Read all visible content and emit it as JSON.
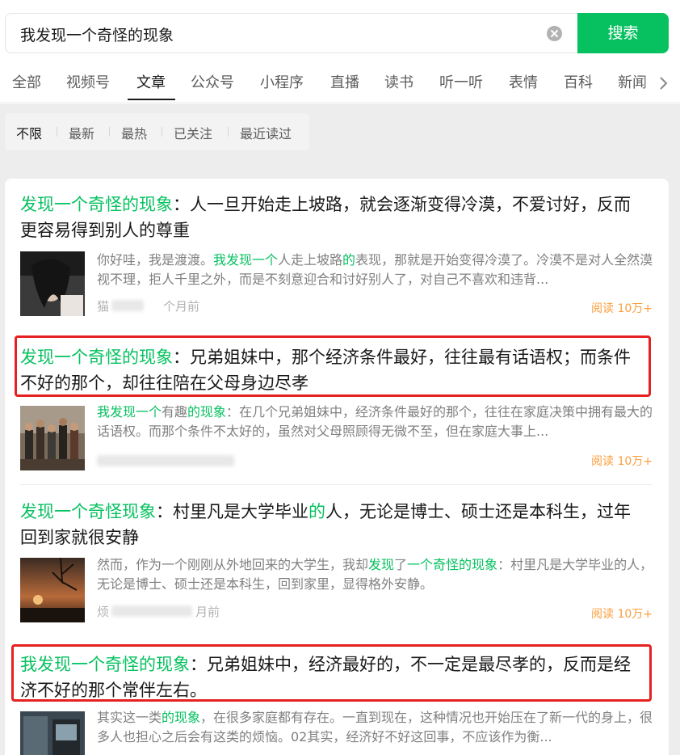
{
  "search": {
    "query": "我发现一个奇怪的现象",
    "button_label": "搜索"
  },
  "tabs": [
    "全部",
    "视频号",
    "文章",
    "公众号",
    "小程序",
    "直播",
    "读书",
    "听一听",
    "表情",
    "百科",
    "新闻"
  ],
  "filters": [
    "不限",
    "最新",
    "最热",
    "已关注",
    "最近读过"
  ],
  "results": [
    {
      "title_parts": [
        {
          "text": "发现一个奇怪的现象",
          "hl": true
        },
        {
          "text": "：人一旦开始走上坡路，就会逐渐变得冷漠，不爱讨好，反而更容易得到别人的尊重",
          "hl": false
        }
      ],
      "snippet_parts": [
        {
          "text": "你好哇，我是渡渡。",
          "hl": false
        },
        {
          "text": "我发现一个",
          "hl": true
        },
        {
          "text": "人走上坡路",
          "hl": false
        },
        {
          "text": "的",
          "hl": true
        },
        {
          "text": "表现，那就是开始变得冷漠了。冷漠不是对人全然漠视不理，拒人千里之外，而是不刻意迎合和讨好别人了，对自己不喜欢和违背...",
          "hl": false
        }
      ],
      "source": "猫",
      "time": "个月前",
      "read": "阅读 10万+"
    },
    {
      "title_parts": [
        {
          "text": "发现一个奇怪的现象",
          "hl": true
        },
        {
          "text": "：兄弟姐妹中，那个经济条件最好，往往最有话语权；而条件不好的那个，却往往陪在父母身边尽孝",
          "hl": false
        }
      ],
      "snippet_parts": [
        {
          "text": "我发现一个",
          "hl": true
        },
        {
          "text": "有趣",
          "hl": false
        },
        {
          "text": "的现象",
          "hl": true
        },
        {
          "text": "：在几个兄弟姐妹中，经济条件最好的那个，往往在家庭决策中拥有最大的话语权。而那个条件不太好的，虽然对父母照顾得无微不至，但在家庭大事上...",
          "hl": false
        }
      ],
      "source": "",
      "time": "",
      "read": "阅读 10万+"
    },
    {
      "title_parts": [
        {
          "text": "发现一个奇怪现象",
          "hl": true
        },
        {
          "text": "：村里凡是大学毕业",
          "hl": false
        },
        {
          "text": "的",
          "hl": true
        },
        {
          "text": "人，无论是博士、硕士还是本科生，过年回到家就很安静",
          "hl": false
        }
      ],
      "snippet_parts": [
        {
          "text": "然而，作为一个刚刚从外地回来的大学生，我却",
          "hl": false
        },
        {
          "text": "发现",
          "hl": true
        },
        {
          "text": "了",
          "hl": false
        },
        {
          "text": "一个奇怪的现象",
          "hl": true
        },
        {
          "text": "：村里凡是大学毕业的人，无论是博士、硕士还是本科生，回到家里，显得格外安静。",
          "hl": false
        }
      ],
      "source": "烦",
      "time": "月前",
      "read": "阅读 10万+"
    },
    {
      "title_parts": [
        {
          "text": "我发现一个奇怪的现象",
          "hl": true
        },
        {
          "text": "：兄弟姐妹中，经济最好的，不一定是最尽孝的，反而是经济不好的那个常伴左右。",
          "hl": false
        }
      ],
      "snippet_parts": [
        {
          "text": "其实这一类",
          "hl": false
        },
        {
          "text": "的现象",
          "hl": true
        },
        {
          "text": "，在很多家庭都有存在。一直到现在，这种情况也开始压在了新一代的身上，很多人也担心之后会有这类的烦恼。02其实，经济好不好这回事，不应该作为衡...",
          "hl": false
        }
      ],
      "source": "",
      "time": "",
      "read": ""
    }
  ],
  "colors": {
    "accent": "#07c160",
    "highlight_box": "#e62121",
    "read_count": "#fa9d3b"
  },
  "icons": [
    "clear-icon",
    "chevron-right-icon"
  ]
}
